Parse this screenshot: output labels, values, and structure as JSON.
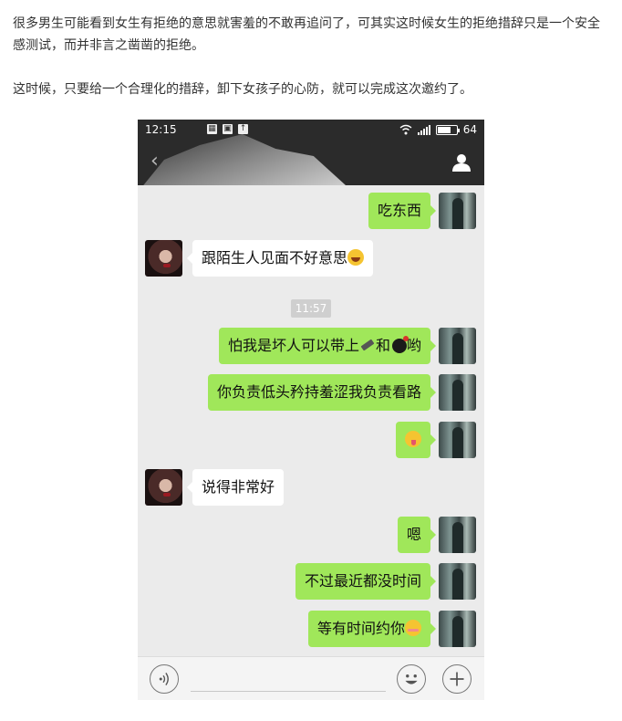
{
  "article": {
    "paragraph1": "很多男生可能看到女生有拒绝的意思就害羞的不敢再追问了，可其实这时候女生的拒绝措辞只是一个安全感测试，而并非言之凿凿的拒绝。",
    "paragraph2": "这时候，只要给一个合理化的措辞，卸下女孩子的心防，就可以完成这次邀约了。"
  },
  "status_bar": {
    "time": "12:15",
    "battery": "64"
  },
  "chat": {
    "timestamp": "11:57",
    "messages": [
      {
        "from": "me",
        "text": "吃东西"
      },
      {
        "from": "them",
        "text": "跟陌生人见面不好意思",
        "emoji": "laughing-tears-emoji"
      },
      {
        "from": "me",
        "text_a": "怕我是坏人可以带上",
        "text_b": "和",
        "text_c": "哟",
        "emoji": [
          "pen-emoji",
          "bomb-emoji"
        ]
      },
      {
        "from": "me",
        "text": "你负责低头矜持羞涩我负责看路"
      },
      {
        "from": "me",
        "text": "",
        "emoji": "wink-tongue-emoji"
      },
      {
        "from": "them",
        "text": "说得非常好"
      },
      {
        "from": "me",
        "text": "嗯"
      },
      {
        "from": "me",
        "text": "不过最近都没时间"
      },
      {
        "from": "me",
        "text": "等有时间约你",
        "emoji": "blushing-emoji"
      }
    ]
  },
  "colors": {
    "my_bubble": "#a0e75a",
    "their_bubble": "#ffffff",
    "chat_bg": "#ebebeb",
    "header_bg": "#2b2b2b"
  },
  "icons": [
    "back-icon",
    "contact-icon",
    "voice-icon",
    "emoji-icon",
    "plus-icon",
    "wifi-icon",
    "signal-icon",
    "battery-icon"
  ]
}
